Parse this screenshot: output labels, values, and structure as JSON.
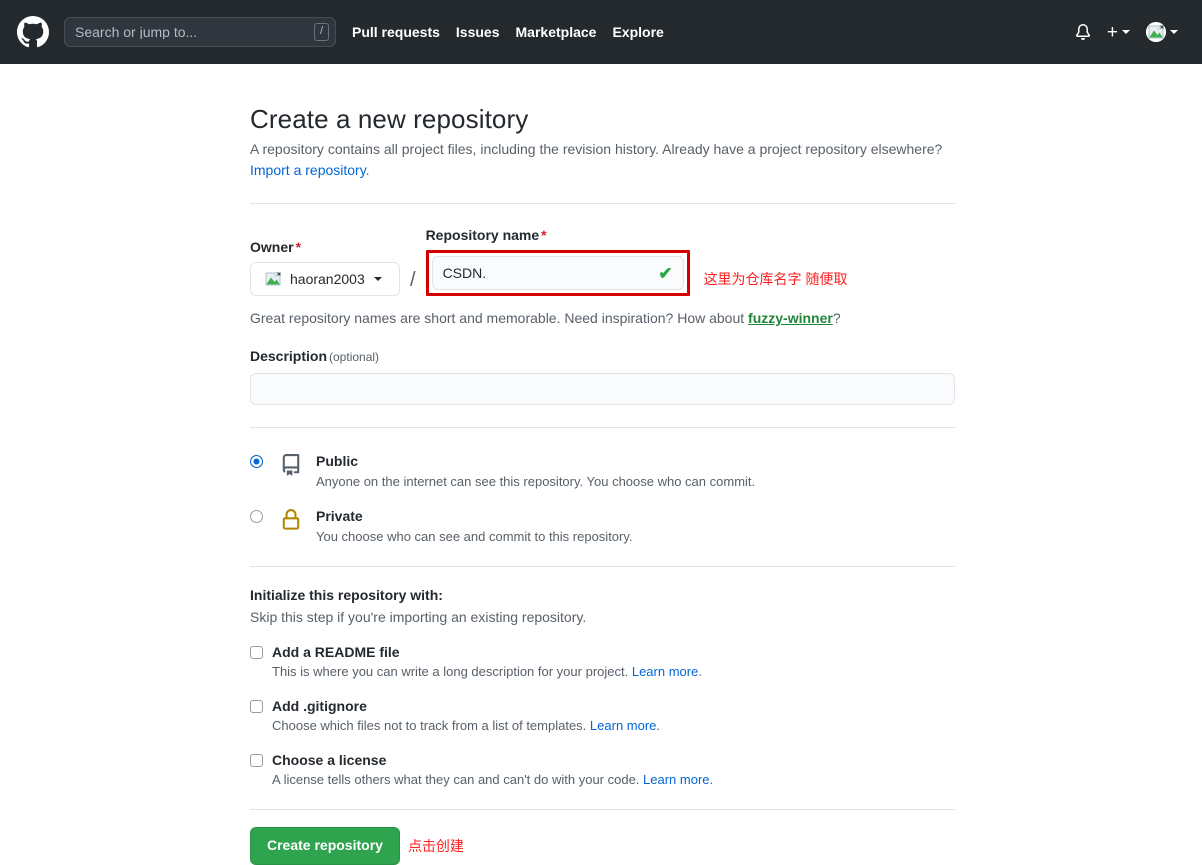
{
  "header": {
    "logo_icon": "github-mark-icon",
    "search": {
      "placeholder": "Search or jump to...",
      "shortcut_key": "/"
    },
    "nav": [
      {
        "label": "Pull requests"
      },
      {
        "label": "Issues"
      },
      {
        "label": "Marketplace"
      },
      {
        "label": "Explore"
      }
    ],
    "notifications_icon": "bell-icon",
    "create_new_icon": "plus-icon",
    "avatar_icon": "broken-image-avatar-icon",
    "background_color": "#24292e"
  },
  "main": {
    "title": "Create a new repository",
    "subtitle_part1": "A repository contains all project files, including the revision history. Already have a project repository elsewhere?",
    "subtitle_link": "Import a repository",
    "subtitle_period": ".",
    "owner": {
      "label": "Owner",
      "required_mark": "*",
      "value": "haoran2003",
      "avatar_icon": "broken-image-avatar-icon",
      "caret_icon": "caret-down-icon"
    },
    "separator": "/",
    "repo_name": {
      "label": "Repository name",
      "required_mark": "*",
      "value": "CSDN.",
      "placeholder": "",
      "valid_icon": "check-icon",
      "valid_color": "#28a745",
      "highlight_box_color": "#d40000"
    },
    "annotation_repo_name": "这里为仓库名字 随便取",
    "hint_text": "Great repository names are short and memorable. Need inspiration? How about ",
    "hint_suggestion": "fuzzy-winner",
    "hint_suffix": "?",
    "description": {
      "label": "Description",
      "optional_label": "(optional)",
      "value": "",
      "placeholder": ""
    },
    "visibility": [
      {
        "id": "public",
        "title": "Public",
        "description": "Anyone on the internet can see this repository. You choose who can commit.",
        "selected": true,
        "icon": "repo-book-icon",
        "icon_color": "#57606a"
      },
      {
        "id": "private",
        "title": "Private",
        "description": "You choose who can see and commit to this repository.",
        "selected": false,
        "icon": "lock-icon",
        "icon_color": "#b08800"
      }
    ],
    "initialize": {
      "title": "Initialize this repository with:",
      "subtitle": "Skip this step if you're importing an existing repository.",
      "options": [
        {
          "label": "Add a README file",
          "description": "This is where you can write a long description for your project. ",
          "link": "Learn more",
          "link_suffix": ".",
          "checked": false
        },
        {
          "label": "Add .gitignore",
          "description": "Choose which files not to track from a list of templates. ",
          "link": "Learn more",
          "link_suffix": ".",
          "checked": false
        },
        {
          "label": "Choose a license",
          "description": "A license tells others what they can and can't do with your code. ",
          "link": "Learn more",
          "link_suffix": ".",
          "checked": false
        }
      ]
    },
    "submit": {
      "label": "Create repository",
      "color": "#2ea44f"
    },
    "annotation_submit": "点击创建"
  }
}
